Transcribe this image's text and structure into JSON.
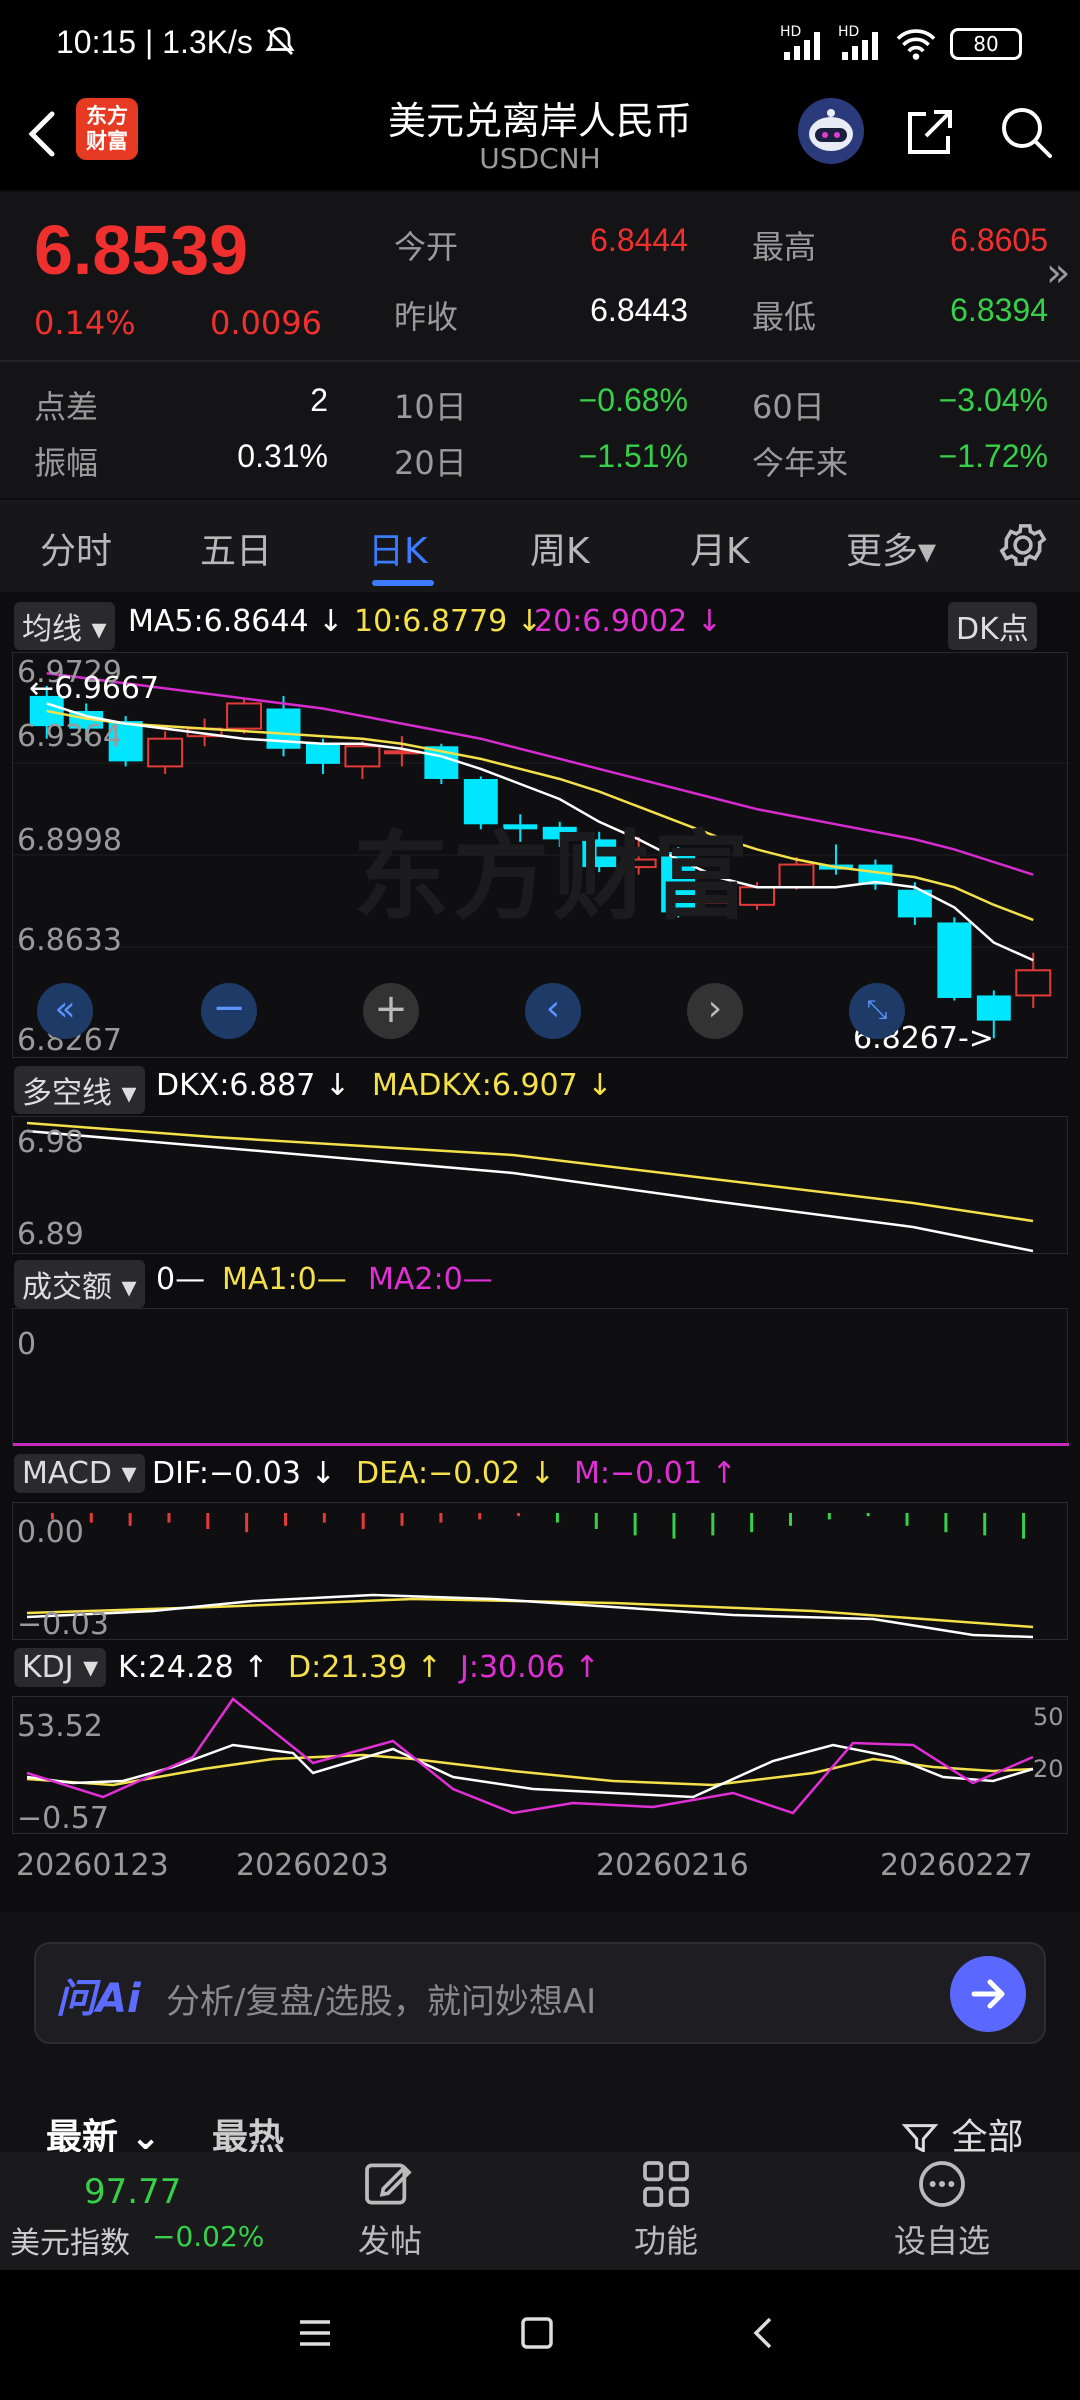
{
  "status": {
    "time": "10:15 | 1.3K/s",
    "battery": "80",
    "signal1": "HD",
    "signal2": "HD"
  },
  "header": {
    "logo_line1": "东方",
    "logo_line2": "财富",
    "title": "美元兑离岸人民币",
    "subtitle": "USDCNH"
  },
  "quote": {
    "price": "6.8539",
    "change_pct": "0.14%",
    "change_abs": "0.0096",
    "open_label": "今开",
    "open": "6.8444",
    "high_label": "最高",
    "high": "6.8605",
    "prev_label": "昨收",
    "prev": "6.8443",
    "low_label": "最低",
    "low": "6.8394",
    "spread_label": "点差",
    "spread": "2",
    "d10_label": "10日",
    "d10": "−0.68%",
    "d60_label": "60日",
    "d60": "−3.04%",
    "amp_label": "振幅",
    "amp": "0.31%",
    "d20_label": "20日",
    "d20": "−1.51%",
    "ytd_label": "今年来",
    "ytd": "−1.72%",
    "more_glyph": "»"
  },
  "tabs": [
    {
      "label": "分时"
    },
    {
      "label": "五日"
    },
    {
      "label": "日K"
    },
    {
      "label": "周K"
    },
    {
      "label": "月K"
    },
    {
      "label": "更多▾"
    }
  ],
  "ma_row": {
    "selector": "均线",
    "ma5": "MA5:6.8644 ↓",
    "ma10": "10:6.8779 ↓",
    "ma20": "20:6.9002 ↓",
    "dk_button": "DK点"
  },
  "kline": {
    "y_labels": [
      "6.9729",
      "6.9364",
      "6.8998",
      "6.8633",
      "6.8267"
    ],
    "high_marker": "←6.9667",
    "low_marker": "6.8267->",
    "watermark": "东方财富",
    "colors": {
      "up": "#e33a3a",
      "down": "#00e6ff",
      "ma5": "#ffffff",
      "ma10": "#f3e04a",
      "ma20": "#d62bd1"
    },
    "candles": [
      {
        "o": 6.963,
        "c": 6.951,
        "h": 6.967,
        "l": 6.946
      },
      {
        "o": 6.957,
        "c": 6.95,
        "h": 6.96,
        "l": 6.945
      },
      {
        "o": 6.953,
        "c": 6.937,
        "h": 6.955,
        "l": 6.935
      },
      {
        "o": 6.935,
        "c": 6.946,
        "h": 6.949,
        "l": 6.932
      },
      {
        "o": 6.947,
        "c": 6.95,
        "h": 6.954,
        "l": 6.943
      },
      {
        "o": 6.95,
        "c": 6.96,
        "h": 6.962,
        "l": 6.948
      },
      {
        "o": 6.958,
        "c": 6.942,
        "h": 6.963,
        "l": 6.939
      },
      {
        "o": 6.944,
        "c": 6.936,
        "h": 6.946,
        "l": 6.932
      },
      {
        "o": 6.935,
        "c": 6.943,
        "h": 6.945,
        "l": 6.93
      },
      {
        "o": 6.941,
        "c": 6.941,
        "h": 6.947,
        "l": 6.935
      },
      {
        "o": 6.943,
        "c": 6.93,
        "h": 6.944,
        "l": 6.928
      },
      {
        "o": 6.93,
        "c": 6.912,
        "h": 6.931,
        "l": 6.91
      },
      {
        "o": 6.912,
        "c": 6.91,
        "h": 6.916,
        "l": 6.905
      },
      {
        "o": 6.911,
        "c": 6.906,
        "h": 6.913,
        "l": 6.903
      },
      {
        "o": 6.906,
        "c": 6.895,
        "h": 6.909,
        "l": 6.893
      },
      {
        "o": 6.895,
        "c": 6.898,
        "h": 6.907,
        "l": 6.892
      },
      {
        "o": 6.901,
        "c": 6.877,
        "h": 6.903,
        "l": 6.875
      },
      {
        "o": 6.877,
        "c": 6.881,
        "h": 6.884,
        "l": 6.876
      },
      {
        "o": 6.88,
        "c": 6.887,
        "h": 6.889,
        "l": 6.878
      },
      {
        "o": 6.887,
        "c": 6.896,
        "h": 6.899,
        "l": 6.886
      },
      {
        "o": 6.896,
        "c": 6.894,
        "h": 6.904,
        "l": 6.892
      },
      {
        "o": 6.896,
        "c": 6.888,
        "h": 6.898,
        "l": 6.886
      },
      {
        "o": 6.886,
        "c": 6.875,
        "h": 6.889,
        "l": 6.872
      },
      {
        "o": 6.873,
        "c": 6.843,
        "h": 6.875,
        "l": 6.842
      },
      {
        "o": 6.844,
        "c": 6.834,
        "h": 6.846,
        "l": 6.827
      },
      {
        "o": 6.844,
        "c": 6.854,
        "h": 6.861,
        "l": 6.839
      }
    ],
    "ma5_line": [
      6.96,
      6.955,
      6.952,
      6.95,
      6.948,
      6.946,
      6.945,
      6.944,
      6.944,
      6.942,
      6.939,
      6.934,
      6.928,
      6.922,
      6.913,
      6.906,
      6.898,
      6.891,
      6.887,
      6.887,
      6.887,
      6.889,
      6.887,
      6.879,
      6.865,
      6.858
    ],
    "ma10_line": [
      6.957,
      6.954,
      6.952,
      6.951,
      6.95,
      6.949,
      6.948,
      6.947,
      6.946,
      6.944,
      6.941,
      6.938,
      6.934,
      6.93,
      6.925,
      6.919,
      6.913,
      6.907,
      6.902,
      6.898,
      6.895,
      6.893,
      6.891,
      6.887,
      6.88,
      6.874
    ],
    "ma20_line": [
      6.972,
      6.97,
      6.968,
      6.966,
      6.964,
      6.962,
      6.96,
      6.958,
      6.955,
      6.952,
      6.949,
      6.946,
      6.942,
      6.938,
      6.934,
      6.93,
      6.926,
      6.922,
      6.918,
      6.915,
      6.912,
      6.909,
      6.906,
      6.902,
      6.897,
      6.892
    ]
  },
  "dkx_row": {
    "selector": "多空线",
    "dkx": "DKX:6.887 ↓",
    "madkx": "MADKX:6.907 ↓",
    "y_labels": [
      "6.98",
      "6.89"
    ]
  },
  "vol_row": {
    "selector": "成交额",
    "vol": "0—",
    "ma1": "MA1:0—",
    "ma2": "MA2:0—",
    "y_label": "0"
  },
  "macd_row": {
    "selector": "MACD",
    "dif": "DIF:−0.03 ↓",
    "dea": "DEA:−0.02 ↓",
    "m": "M:−0.01 ↑",
    "y_labels": [
      "0.00",
      "−0.03"
    ]
  },
  "kdj_row": {
    "selector": "KDJ",
    "k": "K:24.28 ↑",
    "d": "D:21.39 ↑",
    "j": "J:30.06 ↑",
    "y_labels": [
      "53.52",
      "−0.57"
    ],
    "right_labels": [
      "50",
      "20"
    ]
  },
  "dates": [
    "20260123",
    "20260203",
    "20260216",
    "20260227"
  ],
  "ai": {
    "logo": "问Ai",
    "placeholder": "分析/复盘/选股，就问妙想AI"
  },
  "feed_tabs": {
    "latest": "最新",
    "hot": "最热",
    "all": "全部"
  },
  "bottom_nav": {
    "index_value": "97.77",
    "index_name": "美元指数",
    "index_change": "−0.02%",
    "post": "发帖",
    "func": "功能",
    "watch": "设自选"
  }
}
